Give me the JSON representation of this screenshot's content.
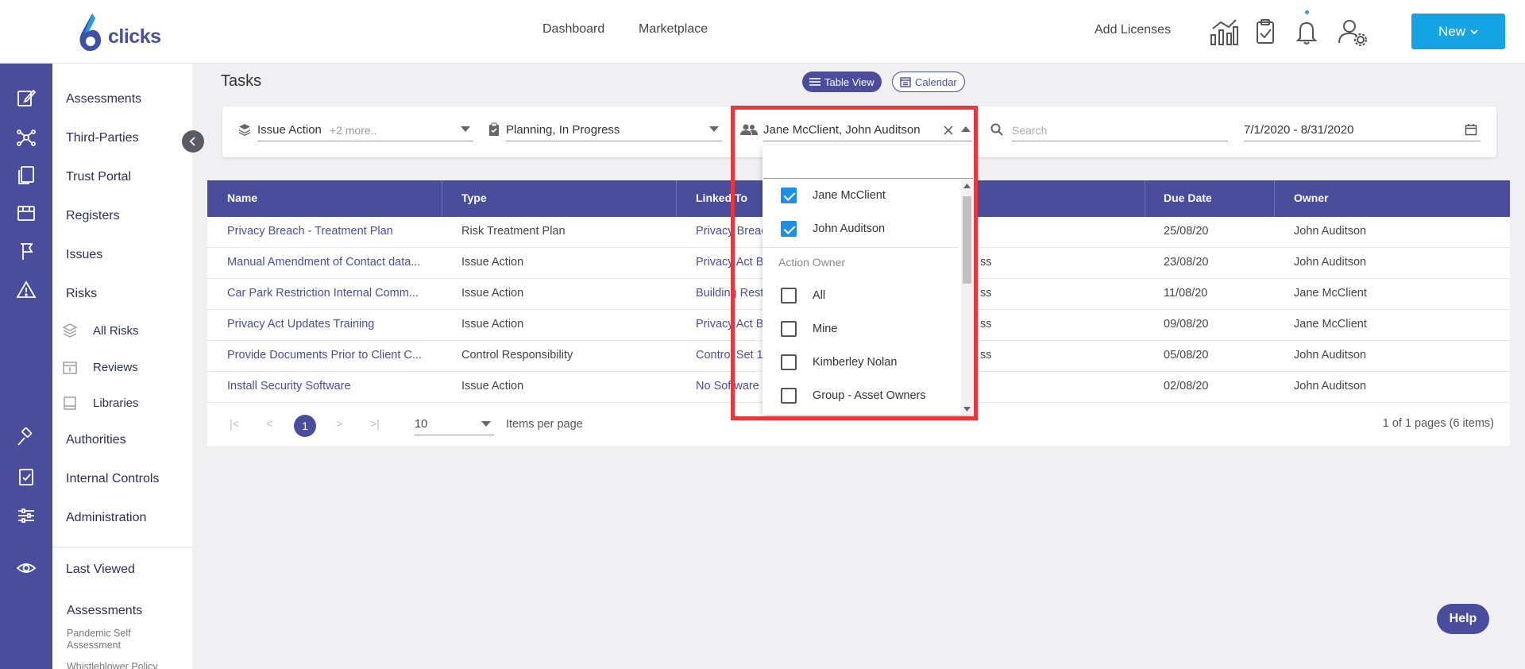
{
  "app": {
    "logo_text": "clicks",
    "nav": [
      {
        "label": "Dashboard"
      },
      {
        "label": "Marketplace"
      }
    ],
    "add_licenses": "Add Licenses",
    "new_button": "New"
  },
  "sidebar": {
    "items": [
      {
        "label": "Assessments"
      },
      {
        "label": "Third-Parties"
      },
      {
        "label": "Trust Portal"
      },
      {
        "label": "Registers"
      },
      {
        "label": "Issues"
      },
      {
        "label": "Risks"
      }
    ],
    "risk_sub": [
      {
        "label": "All Risks"
      },
      {
        "label": "Reviews"
      },
      {
        "label": "Libraries"
      }
    ],
    "items2": [
      {
        "label": "Authorities"
      },
      {
        "label": "Internal Controls"
      },
      {
        "label": "Administration"
      }
    ],
    "last_viewed": "Last Viewed",
    "recent_group": "Assessments",
    "recent": [
      {
        "label": "Pandemic Self Assessment"
      },
      {
        "label": "Whistleblower Policy"
      }
    ]
  },
  "page": {
    "title": "Tasks",
    "view_table": "Table View",
    "view_calendar": "Calendar"
  },
  "filters": {
    "type_value": "Issue Action",
    "type_more": "+2 more..",
    "status_value": "Planning, In Progress",
    "owner_value": "Jane McClient, John Auditson",
    "search_placeholder": "Search",
    "date_range": "7/1/2020 - 8/31/2020"
  },
  "dropdown": {
    "selected": [
      {
        "label": "Jane McClient",
        "checked": true
      },
      {
        "label": "John Auditson",
        "checked": true
      }
    ],
    "group_label": "Action Owner",
    "options": [
      {
        "label": "All",
        "checked": false
      },
      {
        "label": "Mine",
        "checked": false
      },
      {
        "label": "Kimberley Nolan",
        "checked": false
      },
      {
        "label": "Group - Asset Owners",
        "checked": false
      }
    ]
  },
  "table": {
    "columns": [
      "Name",
      "Type",
      "Linked To",
      "Due Date",
      "Owner"
    ],
    "rows": [
      {
        "name": "Privacy Breach - Treatment Plan",
        "type": "Risk Treatment Plan",
        "linked": "Privacy Breach",
        "status": "",
        "due": "25/08/20",
        "owner": "John Auditson"
      },
      {
        "name": "Manual Amendment of Contact data...",
        "type": "Issue Action",
        "linked": "Privacy Act B",
        "status": "ss",
        "due": "23/08/20",
        "owner": "John Auditson"
      },
      {
        "name": "Car Park Restriction Internal Comm...",
        "type": "Issue Action",
        "linked": "Building Rest",
        "status": "ss",
        "due": "11/08/20",
        "owner": "Jane McClient"
      },
      {
        "name": "Privacy Act Updates Training",
        "type": "Issue Action",
        "linked": "Privacy Act B",
        "status": "ss",
        "due": "09/08/20",
        "owner": "Jane McClient"
      },
      {
        "name": "Provide Documents Prior to Client C...",
        "type": "Control Responsibility",
        "linked": "Control Set 1",
        "status": "ss",
        "due": "05/08/20",
        "owner": "John Auditson"
      },
      {
        "name": "Install Security Software",
        "type": "Issue Action",
        "linked": "No Software",
        "status": "",
        "due": "02/08/20",
        "owner": "John Auditson"
      }
    ]
  },
  "pager": {
    "current_page": "1",
    "per_page": "10",
    "per_page_label": "Items per page",
    "summary": "1 of 1 pages (6 items)"
  },
  "help": "Help",
  "colors": {
    "primary": "#4a4d9b",
    "accent": "#14a3e3",
    "highlight": "#e5393d"
  }
}
